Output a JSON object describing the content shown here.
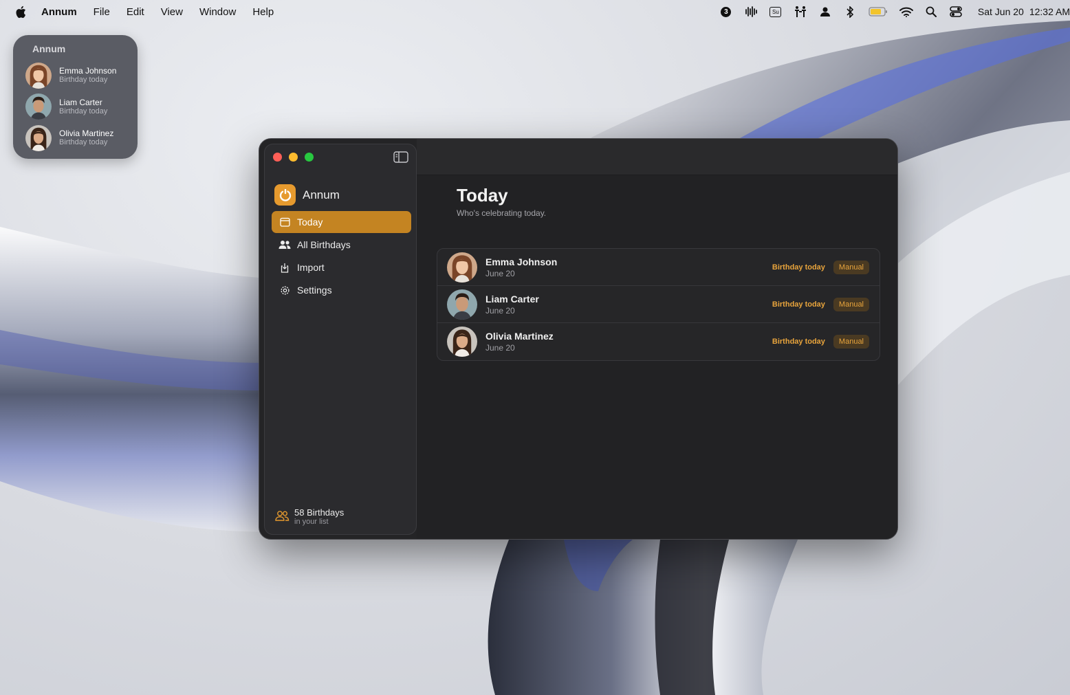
{
  "menubar": {
    "app_name": "Annum",
    "menus": [
      "File",
      "Edit",
      "View",
      "Window",
      "Help"
    ],
    "date": "Sat Jun 20",
    "time": "12:32 AM",
    "status_icons": [
      "notification-count-icon",
      "waveform-icon",
      "su-icon",
      "accessibility-icon",
      "user-icon",
      "bluetooth-icon",
      "battery-icon",
      "wifi-icon",
      "spotlight-search-icon",
      "control-center-icon"
    ],
    "notification_count": "3",
    "su_label": "Su"
  },
  "widget": {
    "title": "Annum",
    "people": [
      {
        "name": "Emma Johnson",
        "subtitle": "Birthday today"
      },
      {
        "name": "Liam Carter",
        "subtitle": "Birthday today"
      },
      {
        "name": "Olivia Martinez",
        "subtitle": "Birthday today"
      }
    ]
  },
  "sidebar": {
    "brand": "Annum",
    "nav": [
      {
        "label": "Today",
        "icon": "calendar-icon",
        "active": true
      },
      {
        "label": "All Birthdays",
        "icon": "people-icon",
        "active": false
      },
      {
        "label": "Import",
        "icon": "import-icon",
        "active": false
      },
      {
        "label": "Settings",
        "icon": "gear-icon",
        "active": false
      }
    ],
    "footer": {
      "count": "58 Birthdays",
      "subtitle": "in your list"
    }
  },
  "main": {
    "title": "Today",
    "subtitle": "Who's celebrating today.",
    "people": [
      {
        "name": "Emma Johnson",
        "date": "June 20",
        "status": "Birthday today",
        "source": "Manual"
      },
      {
        "name": "Liam Carter",
        "date": "June 20",
        "status": "Birthday today",
        "source": "Manual"
      },
      {
        "name": "Olivia Martinez",
        "date": "June 20",
        "status": "Birthday today",
        "source": "Manual"
      }
    ]
  },
  "colors": {
    "accent": "#c48422",
    "brand_icon": "#e69a2e",
    "status_text": "#e8a43c",
    "window_bg": "#242426"
  }
}
